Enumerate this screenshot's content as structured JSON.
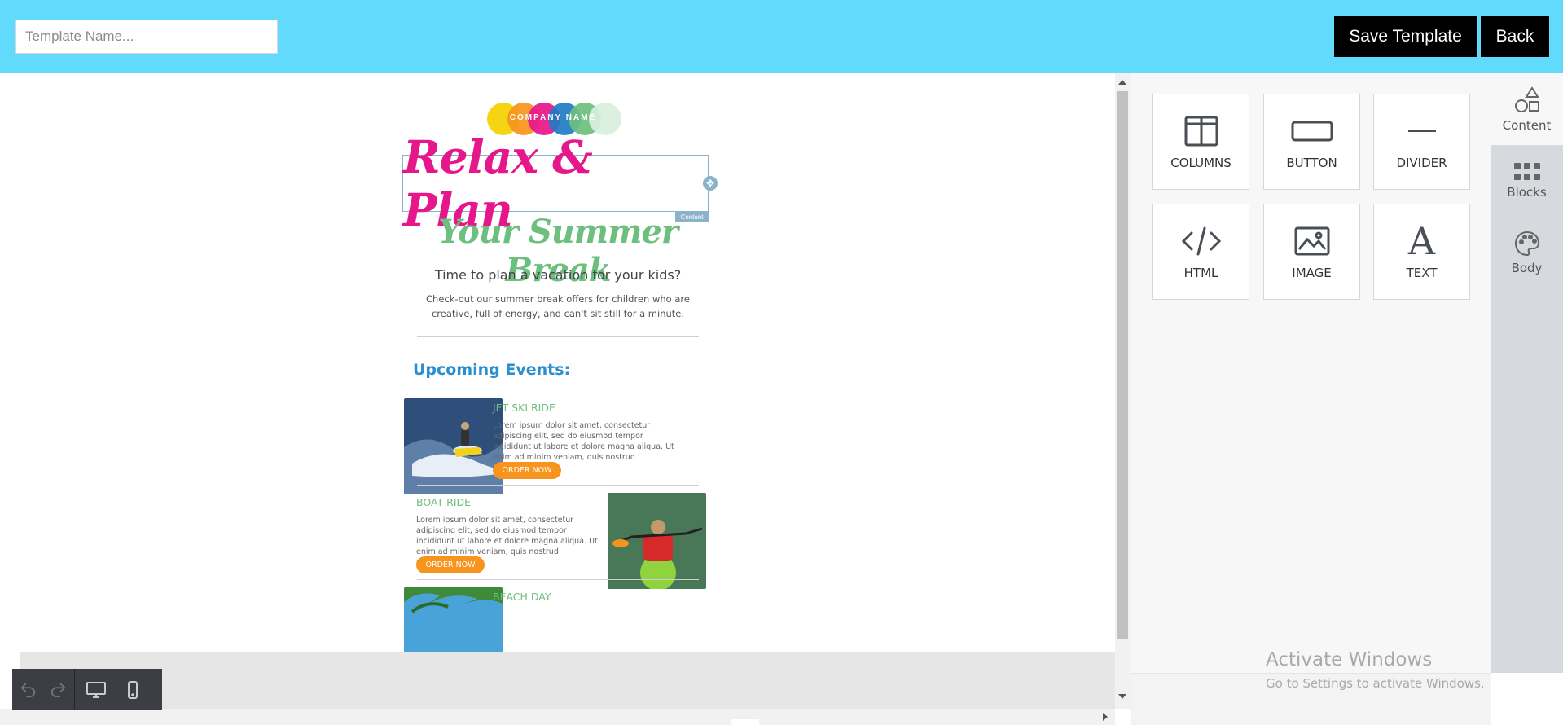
{
  "topbar": {
    "template_name_placeholder": "Template Name...",
    "save_label": "Save Template",
    "back_label": "Back"
  },
  "email": {
    "logo_text": "COMPANY NAME",
    "logo_colors": [
      "#f5d000",
      "#f7941d",
      "#e6178b",
      "#1f7bc4",
      "#6dbf7e",
      "#d9efdc"
    ],
    "headline": "Relax & Plan",
    "content_tag": "Content",
    "subhead": "Your Summer Break",
    "tagline": "Time to plan a vacation for your kids?",
    "description": "Check-out our summer break offers for children who are creative, full of energy, and can't sit still for a minute.",
    "events_title": "Upcoming Events:",
    "events": [
      {
        "name": "JET SKI RIDE",
        "text": "Lorem ipsum dolor sit amet, consectetur adipiscing elit, sed do eiusmod tempor incididunt ut labore et dolore magna aliqua. Ut enim ad minim veniam, quis nostrud exercitation",
        "button": "ORDER NOW"
      },
      {
        "name": "BOAT RIDE",
        "text": "Lorem ipsum dolor sit amet, consectetur adipiscing elit, sed do eiusmod tempor incididunt ut labore et dolore magna aliqua. Ut enim ad minim veniam, quis nostrud exercitation",
        "button": "ORDER NOW"
      },
      {
        "name": "BEACH DAY"
      }
    ]
  },
  "toolbar": {
    "icons": [
      "undo-icon",
      "redo-icon",
      "desktop-icon",
      "mobile-icon"
    ]
  },
  "panel": {
    "tiles": [
      {
        "label": "COLUMNS",
        "icon": "columns-icon"
      },
      {
        "label": "BUTTON",
        "icon": "button-icon"
      },
      {
        "label": "DIVIDER",
        "icon": "divider-icon"
      },
      {
        "label": "HTML",
        "icon": "code-icon"
      },
      {
        "label": "IMAGE",
        "icon": "image-icon"
      },
      {
        "label": "TEXT",
        "icon": "text-icon"
      }
    ],
    "activate_title": "Activate Windows",
    "activate_sub": "Go to Settings to activate Windows."
  },
  "sidetabs": [
    {
      "label": "Content",
      "icon": "shapes-icon",
      "active": true
    },
    {
      "label": "Blocks",
      "icon": "grid-icon",
      "active": false
    },
    {
      "label": "Body",
      "icon": "palette-icon",
      "active": false
    }
  ],
  "colors": {
    "topbar": "#62dafc",
    "headline": "#e6178b",
    "subhead": "#6dbf7e",
    "events_title": "#2a8fcf",
    "order_button": "#f7941d"
  }
}
